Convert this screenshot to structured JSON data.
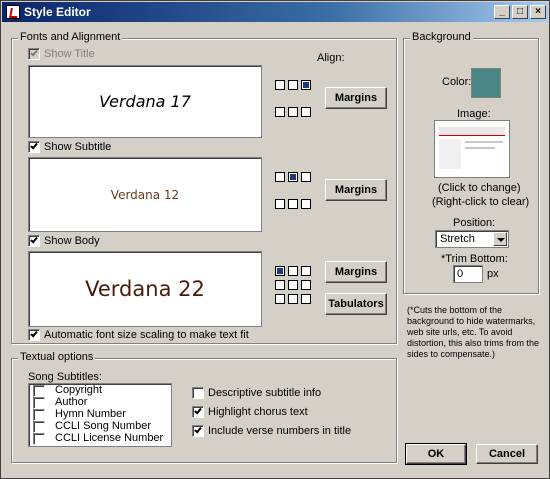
{
  "window": {
    "title": "Style Editor",
    "min": "_",
    "max": "□",
    "close": "×"
  },
  "fonts": {
    "group_label": "Fonts and Alignment",
    "align_label": "Align:",
    "title": {
      "show_label": "Show Title",
      "checked": true,
      "enabled": false,
      "preview": "Verdana 17",
      "margins": "Margins"
    },
    "subtitle": {
      "show_label": "Show Subtitle",
      "checked": true,
      "preview": "Verdana 12",
      "margins": "Margins"
    },
    "body": {
      "show_label": "Show Body",
      "checked": true,
      "preview": "Verdana 22",
      "margins": "Margins",
      "tabulators": "Tabulators"
    },
    "auto_scale": {
      "label": "Automatic font size scaling to make text fit",
      "checked": true
    }
  },
  "background": {
    "group_label": "Background",
    "color_label": "Color:",
    "color": "#4a8585",
    "image_label": "Image:",
    "click_hint": "(Click to change)",
    "right_click_hint": "(Right-click to clear)",
    "position_label": "Position:",
    "position_value": "Stretch",
    "trim_label": "*Trim Bottom:",
    "trim_value": "0",
    "trim_unit": "px",
    "note": "(*Cuts the bottom of the background to hide watermarks, web site urls, etc. To avoid distortion, this also trims from the sides to compensate.)"
  },
  "textual": {
    "group_label": "Textual options",
    "song_subtitles_label": "Song Subtitles:",
    "subtitle_items": [
      {
        "label": "Copyright",
        "checked": false
      },
      {
        "label": "Author",
        "checked": false
      },
      {
        "label": "Hymn Number",
        "checked": false
      },
      {
        "label": "CCLI Song Number",
        "checked": false
      },
      {
        "label": "CCLI License Number",
        "checked": false
      }
    ],
    "descriptive": {
      "label": "Descriptive subtitle info",
      "checked": false
    },
    "highlight": {
      "label": "Highlight chorus text",
      "checked": true
    },
    "verse_numbers": {
      "label": "Include verse numbers in title",
      "checked": true
    }
  },
  "buttons": {
    "ok": "OK",
    "cancel": "Cancel"
  },
  "colors": {
    "title_text": "#000000",
    "subtitle_text": "#6b3a1e",
    "body_text": "#4a1a0a",
    "align_selected": "#1f3a78"
  }
}
